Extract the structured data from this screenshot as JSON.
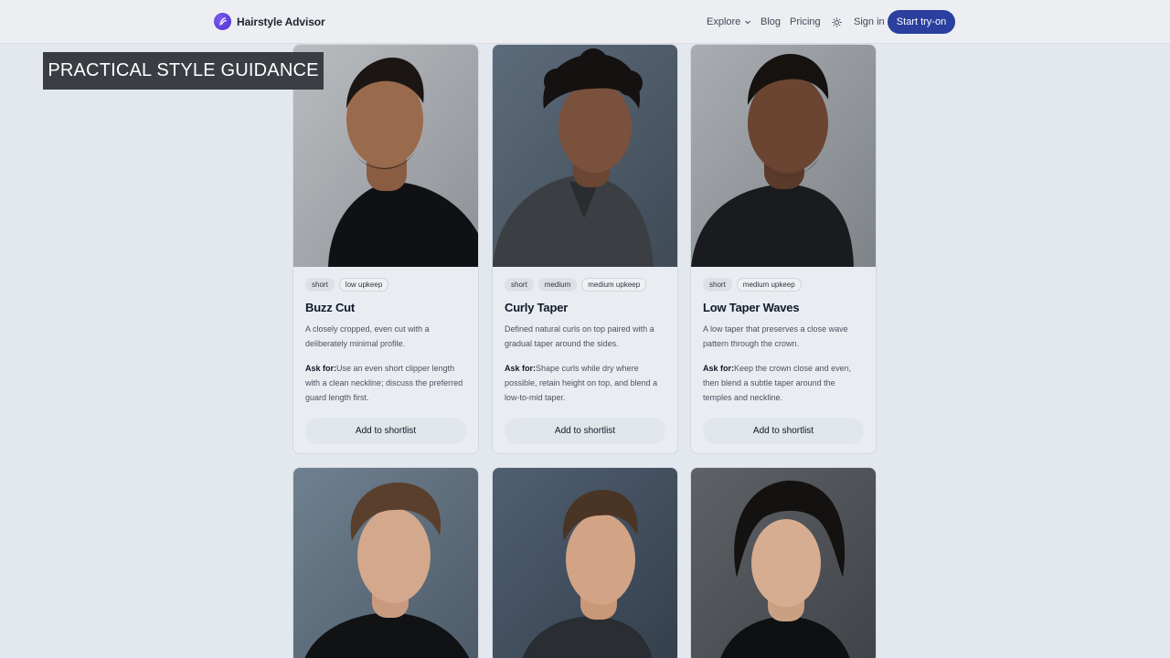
{
  "header": {
    "brand": "Hairstyle Advisor",
    "nav": {
      "explore": "Explore",
      "blog": "Blog",
      "pricing": "Pricing",
      "signin": "Sign in"
    },
    "cta": "Start try-on",
    "accent": "#2a3f9e"
  },
  "overlay": {
    "title": "PRACTICAL STYLE GUIDANCE"
  },
  "cards": [
    {
      "tags": [
        "short",
        "low upkeep"
      ],
      "title": "Buzz Cut",
      "desc": "A closely cropped, even cut with a deliberately minimal profile.",
      "ask_label": "Ask for:",
      "ask": "Use an even short clipper length with a clean neckline; discuss the preferred guard length first.",
      "button": "Add to shortlist"
    },
    {
      "tags": [
        "short",
        "medium",
        "medium upkeep"
      ],
      "title": "Curly Taper",
      "desc": "Defined natural curls on top paired with a gradual taper around the sides.",
      "ask_label": "Ask for:",
      "ask": "Shape curls while dry where possible, retain height on top, and blend a low-to-mid taper.",
      "button": "Add to shortlist"
    },
    {
      "tags": [
        "short",
        "medium upkeep"
      ],
      "title": "Low Taper Waves",
      "desc": "A low taper that preserves a close wave pattern through the crown.",
      "ask_label": "Ask for:",
      "ask": "Keep the crown close and even, then blend a subtle taper around the temples and neckline.",
      "button": "Add to shortlist"
    }
  ]
}
